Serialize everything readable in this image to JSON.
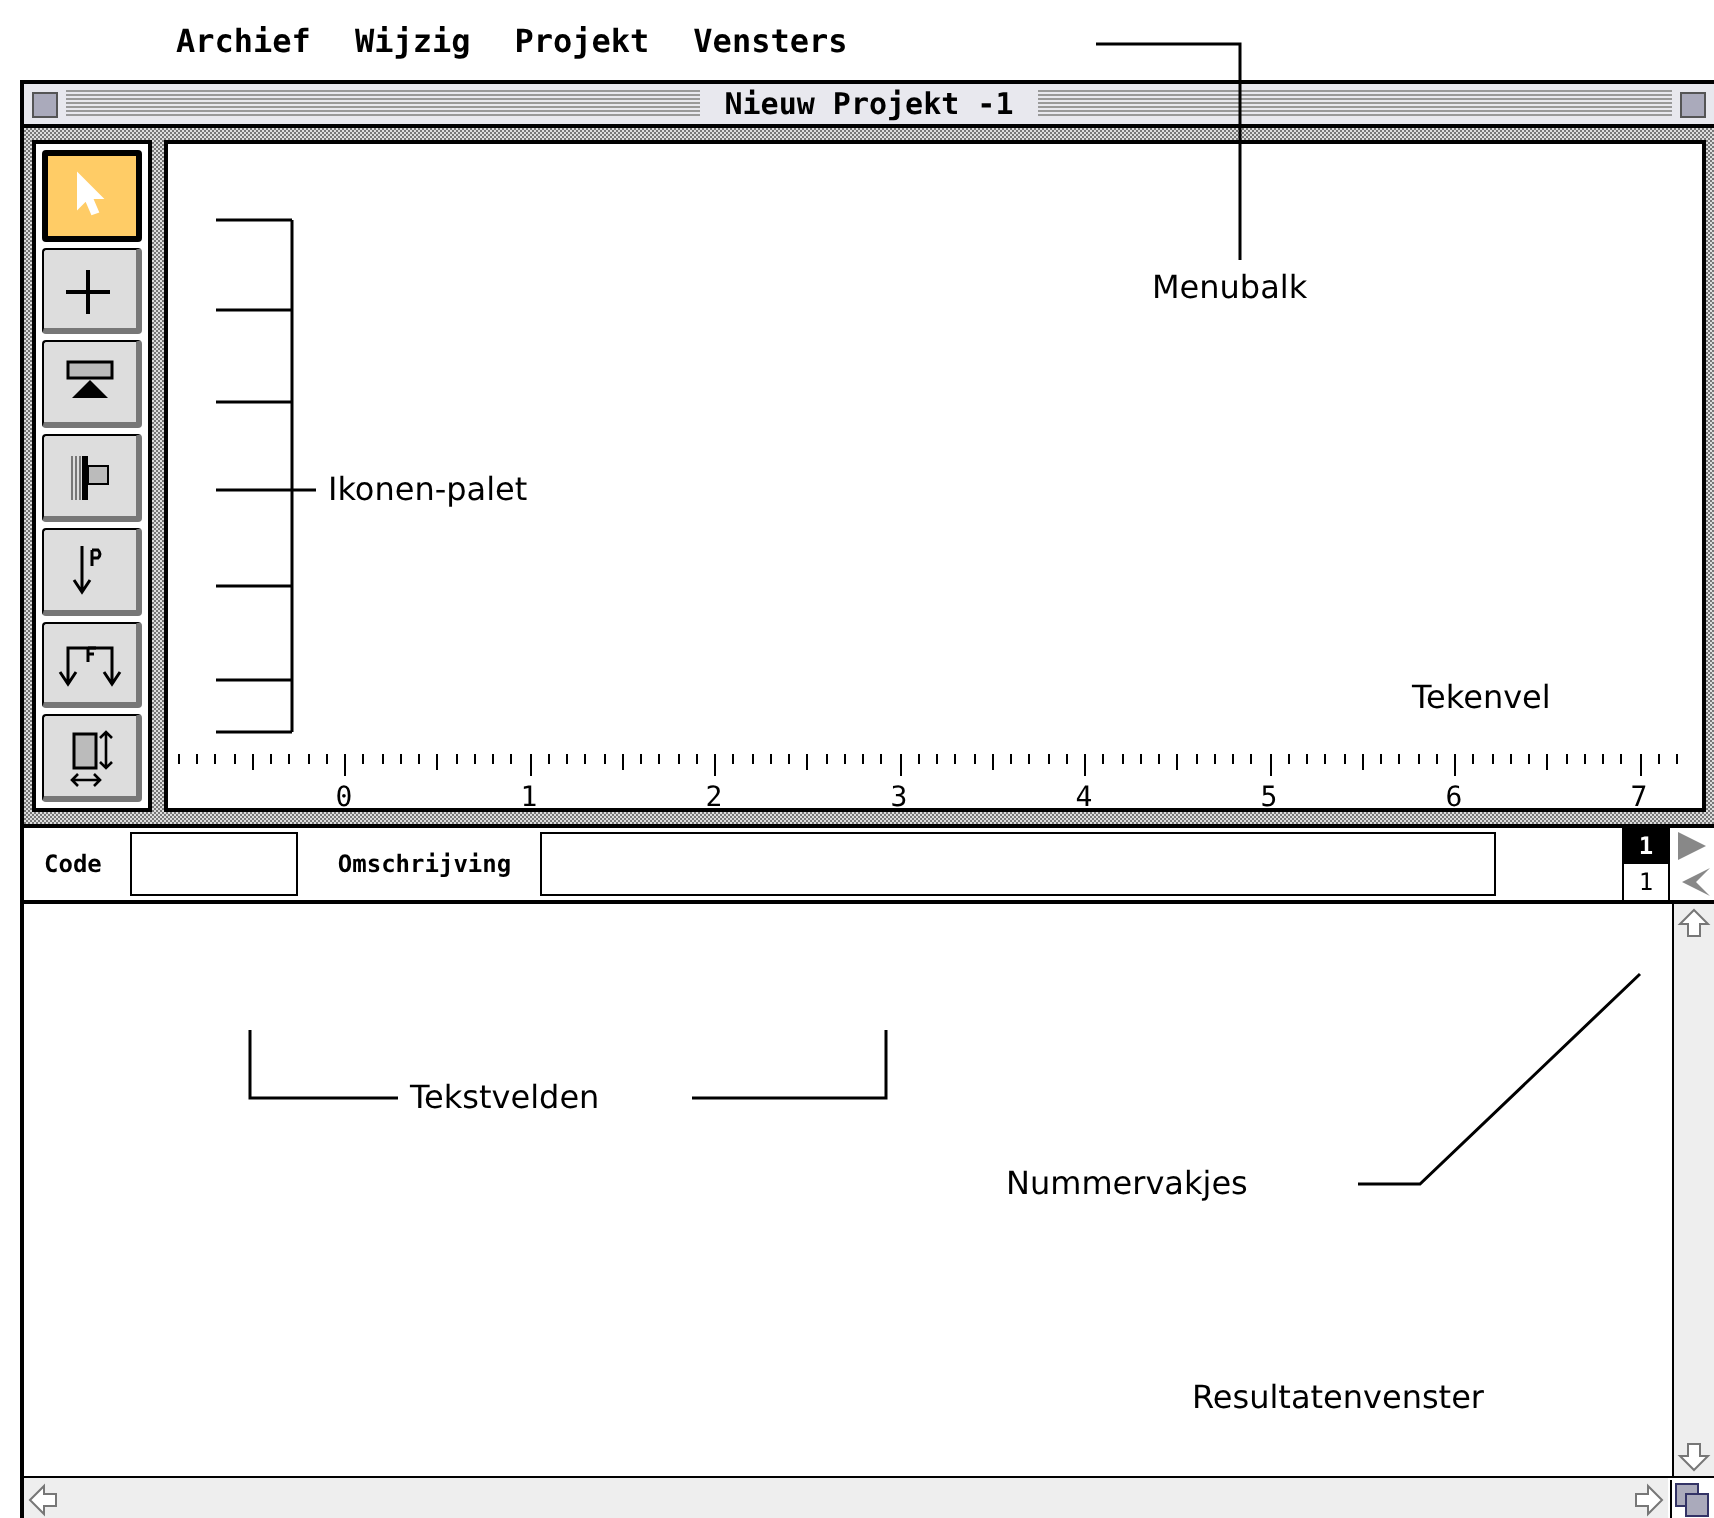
{
  "menu_bar": {
    "items": [
      "Archief",
      "Wijzig",
      "Projekt",
      "Vensters"
    ]
  },
  "window": {
    "title": "Nieuw Projekt -1"
  },
  "tool_palette": {
    "tools": [
      {
        "kind": "arrow",
        "selected": true
      },
      {
        "kind": "cross",
        "selected": false
      },
      {
        "kind": "support",
        "selected": false
      },
      {
        "kind": "wall",
        "selected": false
      },
      {
        "kind": "point-load",
        "selected": false
      },
      {
        "kind": "spread-load",
        "selected": false
      },
      {
        "kind": "section",
        "selected": false
      }
    ]
  },
  "ruler": {
    "labels": [
      "0",
      "1",
      "2",
      "3",
      "4",
      "5",
      "6",
      "7"
    ]
  },
  "fields": [
    {
      "label": "Code"
    },
    {
      "label": "Omschrijving"
    }
  ],
  "number_boxes": [
    {
      "value": "1",
      "selected": true
    },
    {
      "value": "1",
      "selected": false
    }
  ],
  "annotations": [
    {
      "kind": "menu",
      "text": "Menubalk"
    },
    {
      "kind": "palette",
      "text": "Ikonen-palet"
    },
    {
      "kind": "canvas",
      "text": "Tekenvel"
    },
    {
      "kind": "fields",
      "text": "Tekstvelden"
    },
    {
      "kind": "numbers",
      "text": "Nummervakjes"
    },
    {
      "kind": "results",
      "text": "Resultatenvenster"
    }
  ]
}
